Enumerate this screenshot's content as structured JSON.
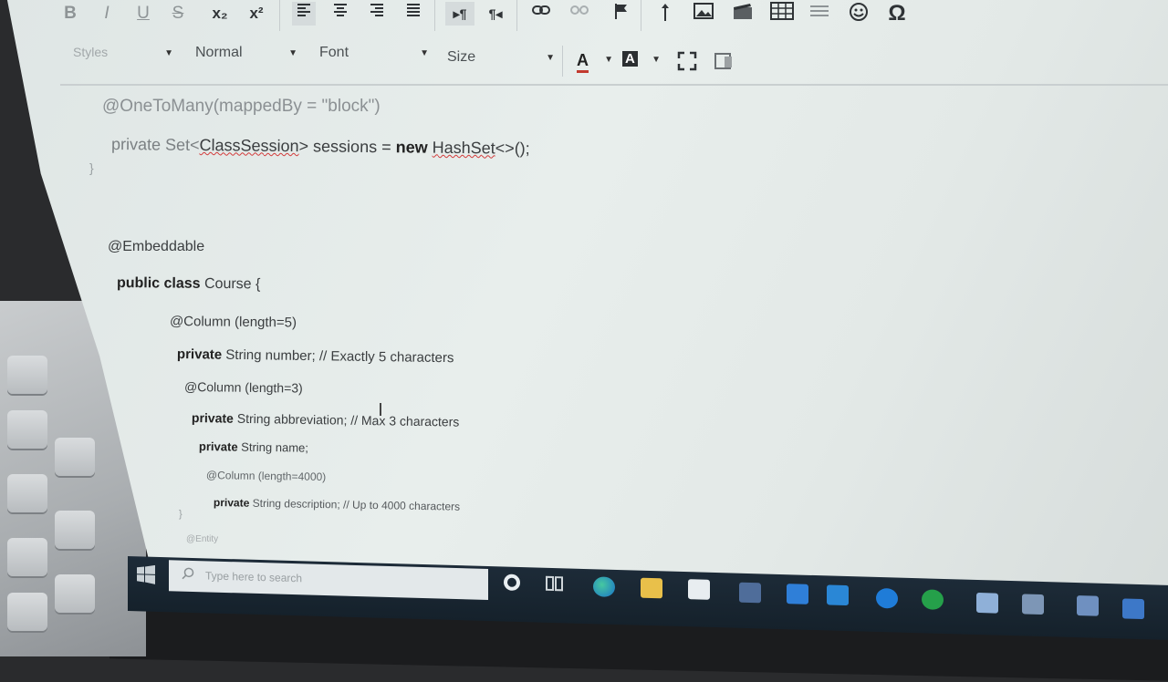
{
  "toolbar": {
    "format_buttons": [
      "B",
      "I",
      "U",
      "S",
      "x₂",
      "x²"
    ],
    "align_icons": [
      "align-left-icon",
      "align-center-icon",
      "align-right-icon",
      "align-justify-icon"
    ],
    "direction_icons": [
      "ltr-icon",
      "rtl-icon"
    ],
    "insert_icons": [
      "link-icon",
      "unlink-icon",
      "flag-icon",
      "anchor-icon",
      "image-icon",
      "media-icon",
      "table-icon",
      "horizontal-rule-icon",
      "smiley-icon",
      "omega-icon"
    ],
    "styles_label": "Styles",
    "format_label": "Normal",
    "font_label": "Font",
    "size_label": "Size",
    "text_color_label": "A",
    "bg_color_label": "A"
  },
  "code": {
    "l1": "@OneToMany(mappedBy = \"block\")",
    "l2a": "private Set<",
    "l2b": "ClassSession",
    "l2c": "> sessions = ",
    "l2d": "new",
    "l2e": " ",
    "l2f": "HashSet",
    "l2g": "<>();",
    "l3": "}",
    "l4": "@Embeddable",
    "l5a": "public class",
    "l5b": " Course {",
    "l6": "@Column (length=5)",
    "l7a": "private",
    "l7b": " String number; // Exactly 5 characters",
    "l8": "@Column (length=3)",
    "l9a": "private",
    "l9b": " String abbreviation; // Max 3 characters",
    "l10a": "private",
    "l10b": " String name;",
    "l11": "@Column (length=4000)",
    "l12a": "private",
    "l12b": " String description; // Up to 4000 characters",
    "l13": "}",
    "l14": "@Entity"
  },
  "taskbar": {
    "search_placeholder": "Type here to search"
  },
  "colors": {
    "screen_bg": "#e3e9e7",
    "taskbar_bg": "#1d2b38",
    "spellcheck": "#d23a3a"
  }
}
